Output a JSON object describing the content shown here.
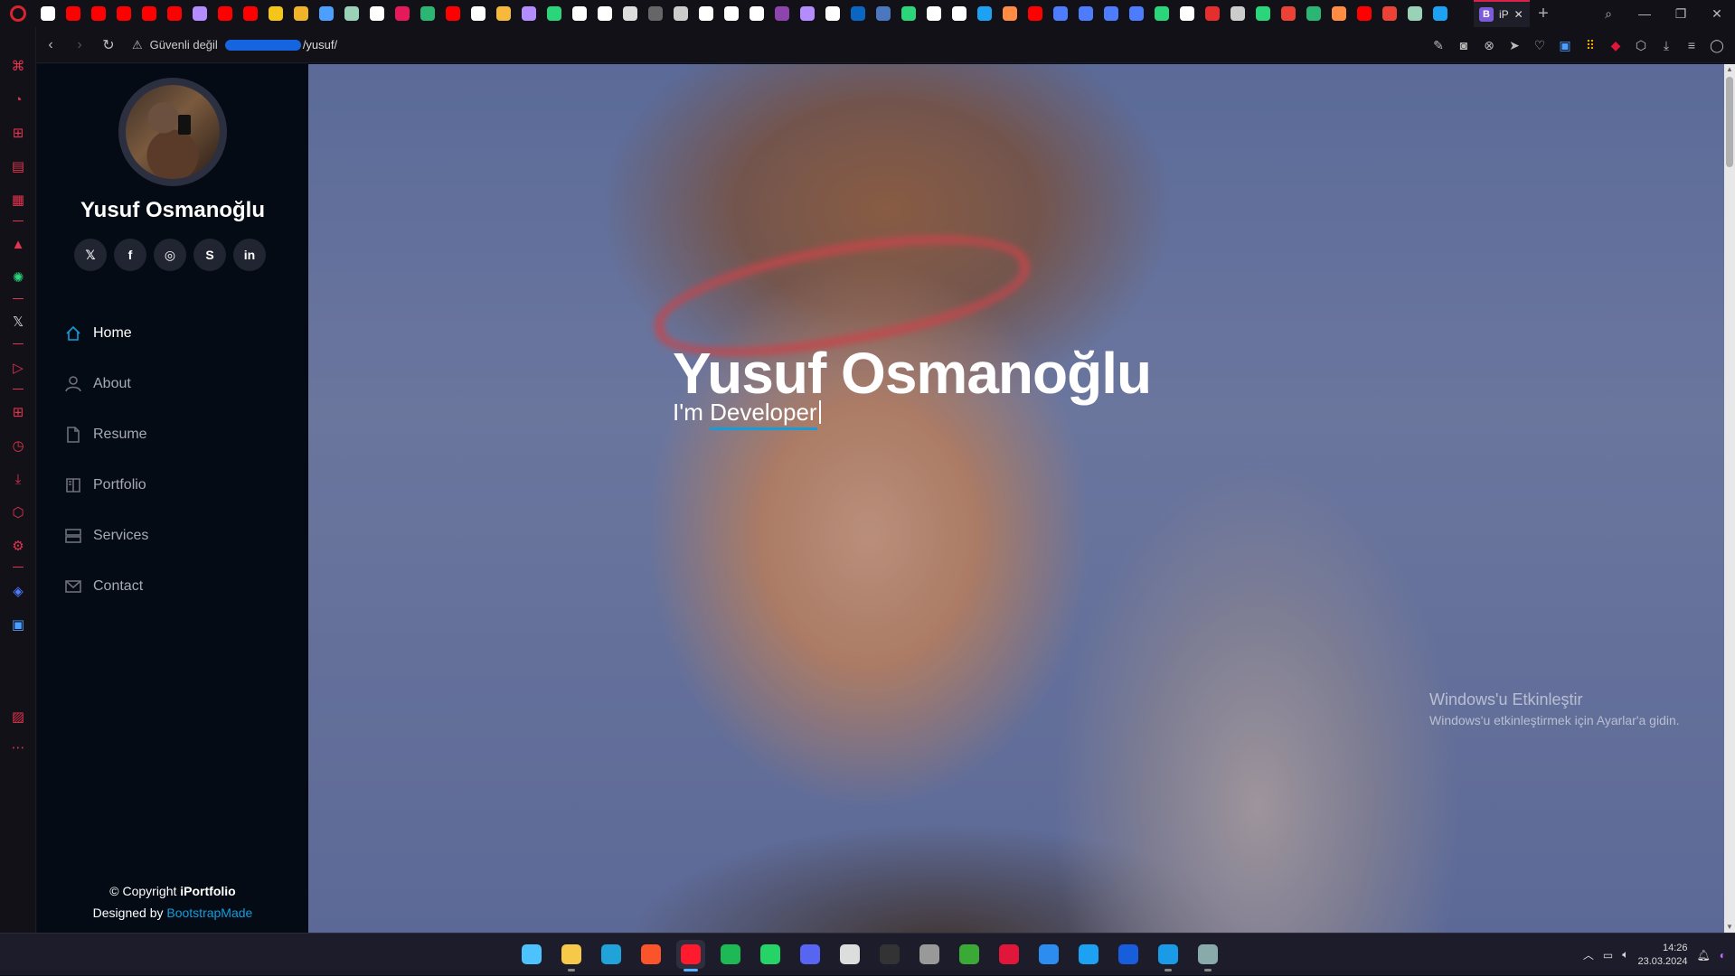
{
  "browser": {
    "active_tab_label": "iP",
    "tab_colors": [
      "#ffffff",
      "#ff0000",
      "#ff0000",
      "#ff0000",
      "#ff0000",
      "#ff0000",
      "#b38cff",
      "#ff0000",
      "#ff0000",
      "#f5c518",
      "#f0b429",
      "#4d9fff",
      "#9ad2b8",
      "#ffffff",
      "#e6195a",
      "#2bb673",
      "#ff0000",
      "#ffffff",
      "#f6b93b",
      "#b38cff",
      "#2bd67b",
      "#ffffff",
      "#ffffff",
      "#dddddd",
      "#666666",
      "#cccccc",
      "#ffffff",
      "#ffffff",
      "#ffffff",
      "#8e44ad",
      "#b38cff",
      "#ffffff",
      "#0a66c2",
      "#4b77be",
      "#2bd67b",
      "#ffffff",
      "#ffffff",
      "#1da1f2",
      "#ff8c42",
      "#ff0000",
      "#4d7cff",
      "#4d7cff",
      "#4d7cff",
      "#4d7cff",
      "#2bd67b",
      "#ffffff",
      "#e62e2e",
      "#cccccc",
      "#2bd67b",
      "#ea4335",
      "#2bb673",
      "#ff8c42",
      "#ff0000",
      "#ea4335",
      "#9ad2b8",
      "#1da1f2"
    ],
    "new_tab_symbol": "+",
    "close_tab_symbol": "✕",
    "security_label": "Güvenli değil",
    "url_path": "/yusuf/"
  },
  "site": {
    "name": "Yusuf Osmanoğlu",
    "socials": [
      {
        "icon": "twitter-icon",
        "glyph": "𝕏"
      },
      {
        "icon": "facebook-icon",
        "glyph": "f"
      },
      {
        "icon": "instagram-icon",
        "glyph": "◎"
      },
      {
        "icon": "skype-icon",
        "glyph": "S"
      },
      {
        "icon": "linkedin-icon",
        "glyph": "in"
      }
    ],
    "nav": [
      {
        "label": "Home",
        "icon": "home-icon",
        "active": true
      },
      {
        "label": "About",
        "icon": "person-icon",
        "active": false
      },
      {
        "label": "Resume",
        "icon": "file-icon",
        "active": false
      },
      {
        "label": "Portfolio",
        "icon": "book-icon",
        "active": false
      },
      {
        "label": "Services",
        "icon": "server-icon",
        "active": false
      },
      {
        "label": "Contact",
        "icon": "envelope-icon",
        "active": false
      }
    ],
    "footer": {
      "copyright_prefix": "© Copyright ",
      "brand": "iPortfolio",
      "designed_by": "Designed by ",
      "designer": "BootstrapMade"
    },
    "accent_color": "#149ddd"
  },
  "hero": {
    "title": "Yusuf Osmanoğlu",
    "prefix": "I'm ",
    "typed": "Developer"
  },
  "watermark": {
    "line1": "Windows'u Etkinleştir",
    "line2": "Windows'u etkinleştirmek için Ayarlar'a gidin."
  },
  "taskbar": {
    "apps": [
      {
        "name": "start-icon",
        "color": "#4cc2ff",
        "open": false
      },
      {
        "name": "file-explorer-icon",
        "color": "#f7c948",
        "open": true
      },
      {
        "name": "edge-icon",
        "color": "#1fa3d9",
        "open": false
      },
      {
        "name": "brave-icon",
        "color": "#fb542b",
        "open": false
      },
      {
        "name": "opera-icon",
        "color": "#ff1b2d",
        "open": true,
        "active": true
      },
      {
        "name": "spotify-icon",
        "color": "#1db954",
        "open": false
      },
      {
        "name": "whatsapp-icon",
        "color": "#25d366",
        "open": false
      },
      {
        "name": "discord-icon",
        "color": "#5865f2",
        "open": false
      },
      {
        "name": "store-icon",
        "color": "#dddddd",
        "open": false
      },
      {
        "name": "terminal-icon",
        "color": "#333333",
        "open": false
      },
      {
        "name": "unity-icon",
        "color": "#999999",
        "open": false
      },
      {
        "name": "minecraft-icon",
        "color": "#3aa935",
        "open": false
      },
      {
        "name": "amd-icon",
        "color": "#e0173b",
        "open": false
      },
      {
        "name": "app-store-icon",
        "color": "#2d8cf0",
        "open": false
      },
      {
        "name": "twitter-app-icon",
        "color": "#1da1f2",
        "open": false
      },
      {
        "name": "bitwarden-icon",
        "color": "#175ddc",
        "open": false
      },
      {
        "name": "onedrive-icon",
        "color": "#1a9be8",
        "open": true
      },
      {
        "name": "photos-icon",
        "color": "#8aa",
        "open": true
      }
    ],
    "time": "14:26",
    "date": "23.03.2024"
  }
}
